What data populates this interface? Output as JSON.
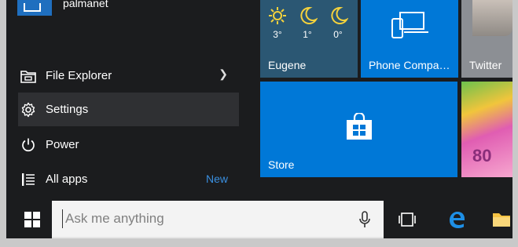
{
  "user": {
    "name": "palmanet"
  },
  "menu_items": [
    {
      "label": "File Explorer",
      "icon": "folder-icon"
    },
    {
      "label": "Settings",
      "icon": "gear-icon"
    },
    {
      "label": "Power",
      "icon": "power-icon"
    },
    {
      "label": "All apps",
      "icon": "list-icon",
      "badge": "New"
    }
  ],
  "tiles": {
    "weather": {
      "label": "Eugene",
      "days": [
        {
          "icon": "sun-icon",
          "temp": "3°"
        },
        {
          "icon": "moon-icon",
          "temp": "1°"
        },
        {
          "icon": "moon-icon",
          "temp": "0°"
        }
      ]
    },
    "phone": {
      "label": "Phone Compa…"
    },
    "twitter": {
      "label": "Twitter"
    },
    "store": {
      "label": "Store"
    },
    "candy": {
      "number": "80"
    }
  },
  "taskbar": {
    "search_placeholder": "Ask me anything"
  },
  "colors": {
    "accent": "#0078d7",
    "weather_tile": "#2b5773",
    "menu_bg": "#1b1c1e",
    "new_badge": "#3a8fe0"
  }
}
